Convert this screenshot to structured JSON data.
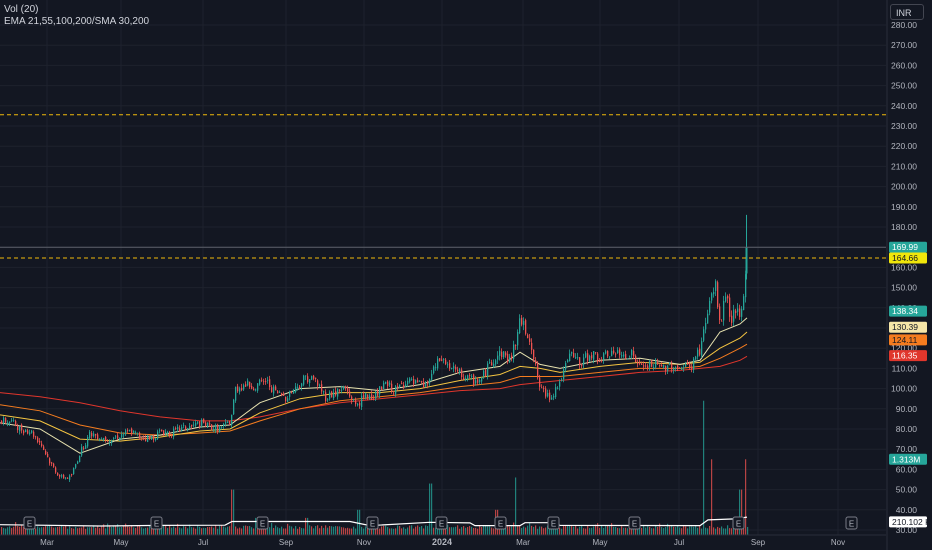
{
  "legend": {
    "volume": "Vol (20)",
    "ema": "EMA 21,55,100,200/SMA 30,200"
  },
  "currency_button": "INR",
  "colors": {
    "up": "#26a69a",
    "down": "#ef5350",
    "ema_fast": "#e8e3b0",
    "ema_mid": "#f5c542",
    "ema_slow": "#f57c1f",
    "sma_long": "#e0362c",
    "vol_sma": "#ffffff",
    "dashed_level": "#f0b90b"
  },
  "chart_data": {
    "type": "candlestick",
    "price_axis": {
      "min": 30,
      "max": 290,
      "ticks": [
        30,
        40,
        50,
        60,
        70,
        80,
        90,
        100,
        110,
        120,
        130,
        140,
        150,
        160,
        170,
        180,
        190,
        200,
        210,
        220,
        230,
        240,
        250,
        260,
        270,
        280
      ]
    },
    "time_axis": {
      "labels": [
        "Mar",
        "May",
        "Jul",
        "Sep",
        "Nov",
        "2024",
        "Mar",
        "May",
        "Jul",
        "Sep",
        "Nov"
      ]
    },
    "earnings_markers": [
      "E",
      "E",
      "E",
      "E",
      "E",
      "E",
      "E",
      "E",
      "E",
      "E"
    ],
    "horizontal_levels": [
      {
        "value": 235.54,
        "label": "235.54",
        "style": "dashed"
      },
      {
        "value": 164.66,
        "label": "164.66",
        "style": "dashed"
      },
      {
        "value": 169.99,
        "label": "169.99",
        "style": "solid"
      }
    ],
    "price_labels": [
      {
        "label": "169.99",
        "value": 169.99,
        "color": "#26a69a"
      },
      {
        "label": "164.66",
        "value": 164.66,
        "color": "#f0e60b"
      },
      {
        "label": "138.34",
        "value": 138.34,
        "color": "#26a69a"
      },
      {
        "label": "130.39",
        "value": 130.39,
        "color": "#f5e6a8"
      },
      {
        "label": "124.11",
        "value": 124.11,
        "color": "#f57c1f"
      },
      {
        "label": "116.35",
        "value": 116.35,
        "color": "#e0362c"
      },
      {
        "label": "1.313M",
        "value": 65,
        "color": "#26a69a"
      },
      {
        "label": "210.102 K",
        "value": 34,
        "color": "#ffffff"
      }
    ],
    "price_path": [
      [
        0,
        84
      ],
      [
        10,
        84
      ],
      [
        20,
        80
      ],
      [
        30,
        79
      ],
      [
        40,
        73
      ],
      [
        50,
        63
      ],
      [
        60,
        56
      ],
      [
        70,
        56
      ],
      [
        80,
        69
      ],
      [
        90,
        78
      ],
      [
        100,
        76
      ],
      [
        110,
        75
      ],
      [
        120,
        77
      ],
      [
        130,
        79
      ],
      [
        140,
        76
      ],
      [
        150,
        75
      ],
      [
        160,
        79
      ],
      [
        170,
        78
      ],
      [
        180,
        80
      ],
      [
        190,
        81
      ],
      [
        200,
        83
      ],
      [
        210,
        81
      ],
      [
        220,
        80
      ],
      [
        230,
        84
      ],
      [
        235,
        100
      ],
      [
        245,
        102
      ],
      [
        255,
        101
      ],
      [
        265,
        104
      ],
      [
        275,
        98
      ],
      [
        285,
        96
      ],
      [
        295,
        100
      ],
      [
        305,
        106
      ],
      [
        315,
        104
      ],
      [
        325,
        96
      ],
      [
        335,
        98
      ],
      [
        345,
        100
      ],
      [
        355,
        92
      ],
      [
        365,
        96
      ],
      [
        375,
        97
      ],
      [
        385,
        102
      ],
      [
        395,
        99
      ],
      [
        405,
        104
      ],
      [
        415,
        102
      ],
      [
        425,
        101
      ],
      [
        430,
        106
      ],
      [
        440,
        115
      ],
      [
        450,
        110
      ],
      [
        460,
        107
      ],
      [
        470,
        104
      ],
      [
        480,
        104
      ],
      [
        490,
        113
      ],
      [
        500,
        118
      ],
      [
        510,
        114
      ],
      [
        520,
        134
      ],
      [
        530,
        124
      ],
      [
        535,
        110
      ],
      [
        540,
        99
      ],
      [
        550,
        96
      ],
      [
        560,
        104
      ],
      [
        570,
        117
      ],
      [
        580,
        112
      ],
      [
        590,
        118
      ],
      [
        600,
        114
      ],
      [
        610,
        118
      ],
      [
        620,
        116
      ],
      [
        630,
        118
      ],
      [
        640,
        110
      ],
      [
        650,
        112
      ],
      [
        660,
        110
      ],
      [
        670,
        112
      ],
      [
        680,
        110
      ],
      [
        690,
        111
      ],
      [
        700,
        120
      ],
      [
        710,
        145
      ],
      [
        715,
        150
      ],
      [
        720,
        130
      ],
      [
        725,
        148
      ],
      [
        730,
        134
      ],
      [
        735,
        140
      ],
      [
        740,
        132
      ],
      [
        745,
        155
      ],
      [
        747,
        170
      ]
    ],
    "ema21_path": [
      [
        0,
        83
      ],
      [
        40,
        80
      ],
      [
        80,
        68
      ],
      [
        120,
        75
      ],
      [
        160,
        77
      ],
      [
        200,
        81
      ],
      [
        230,
        82
      ],
      [
        260,
        93
      ],
      [
        300,
        100
      ],
      [
        340,
        101
      ],
      [
        380,
        99
      ],
      [
        420,
        102
      ],
      [
        460,
        108
      ],
      [
        500,
        111
      ],
      [
        520,
        118
      ],
      [
        540,
        112
      ],
      [
        560,
        110
      ],
      [
        600,
        114
      ],
      [
        640,
        115
      ],
      [
        680,
        112
      ],
      [
        700,
        114
      ],
      [
        720,
        128
      ],
      [
        740,
        132
      ],
      [
        747,
        135
      ]
    ],
    "ema55_path": [
      [
        0,
        87
      ],
      [
        40,
        84
      ],
      [
        80,
        75
      ],
      [
        120,
        74
      ],
      [
        160,
        76
      ],
      [
        200,
        79
      ],
      [
        230,
        80
      ],
      [
        260,
        88
      ],
      [
        300,
        95
      ],
      [
        340,
        98
      ],
      [
        380,
        98
      ],
      [
        420,
        100
      ],
      [
        460,
        104
      ],
      [
        500,
        107
      ],
      [
        520,
        111
      ],
      [
        540,
        110
      ],
      [
        560,
        108
      ],
      [
        600,
        111
      ],
      [
        640,
        113
      ],
      [
        680,
        112
      ],
      [
        700,
        113
      ],
      [
        720,
        120
      ],
      [
        740,
        125
      ],
      [
        747,
        128
      ]
    ],
    "ema100_path": [
      [
        0,
        92
      ],
      [
        40,
        89
      ],
      [
        80,
        82
      ],
      [
        120,
        78
      ],
      [
        160,
        77
      ],
      [
        200,
        78
      ],
      [
        230,
        79
      ],
      [
        260,
        84
      ],
      [
        300,
        90
      ],
      [
        340,
        94
      ],
      [
        380,
        96
      ],
      [
        420,
        98
      ],
      [
        460,
        101
      ],
      [
        500,
        103
      ],
      [
        520,
        106
      ],
      [
        540,
        106
      ],
      [
        560,
        106
      ],
      [
        600,
        108
      ],
      [
        640,
        110
      ],
      [
        680,
        110
      ],
      [
        700,
        111
      ],
      [
        720,
        115
      ],
      [
        740,
        120
      ],
      [
        747,
        122
      ]
    ],
    "sma200_path": [
      [
        0,
        98
      ],
      [
        40,
        96
      ],
      [
        80,
        93
      ],
      [
        120,
        89
      ],
      [
        160,
        86
      ],
      [
        200,
        84
      ],
      [
        230,
        84
      ],
      [
        260,
        86
      ],
      [
        300,
        90
      ],
      [
        340,
        93
      ],
      [
        380,
        95
      ],
      [
        420,
        97
      ],
      [
        460,
        99
      ],
      [
        500,
        100
      ],
      [
        520,
        102
      ],
      [
        540,
        103
      ],
      [
        560,
        104
      ],
      [
        600,
        106
      ],
      [
        640,
        108
      ],
      [
        680,
        109
      ],
      [
        700,
        110
      ],
      [
        720,
        111
      ],
      [
        740,
        114
      ],
      [
        747,
        116
      ]
    ],
    "volume_spikes": [
      [
        232,
        50
      ],
      [
        256,
        36
      ],
      [
        306,
        36
      ],
      [
        358,
        40
      ],
      [
        430,
        53
      ],
      [
        496,
        40
      ],
      [
        515,
        56
      ],
      [
        703,
        94
      ],
      [
        711,
        65
      ],
      [
        740,
        50
      ],
      [
        745,
        65
      ]
    ]
  }
}
